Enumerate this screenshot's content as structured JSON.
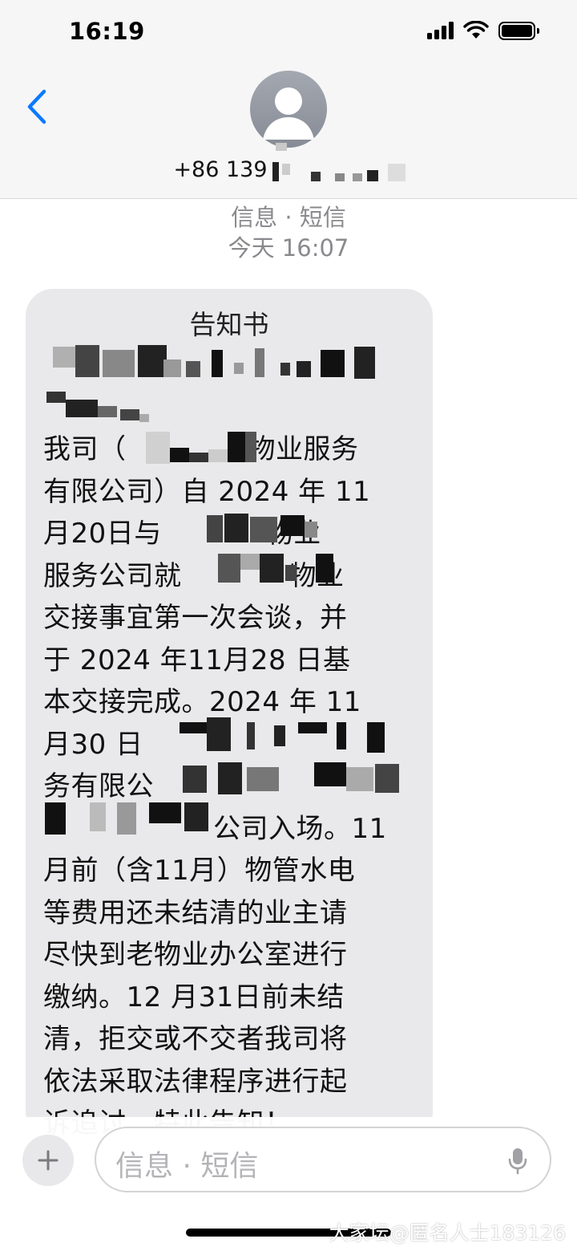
{
  "status_bar": {
    "time": "16:19"
  },
  "contact": {
    "number_prefix": "+86 139"
  },
  "meta": {
    "channel": "信息 · 短信",
    "timestamp": "今天 16:07"
  },
  "message": {
    "title": "告知书",
    "lines": [
      "我司（",
      "物业服务",
      "有限公司）自 2024 年 11",
      "月20日与",
      "物业",
      "服务公司就",
      "物业",
      "交接事宜第一次会谈，并",
      "于 2024 年11月28 日基",
      "本交接完成。2024 年 11",
      "月30 日",
      "务有限公",
      "公司入场。11",
      "月前（含11月）物管水电",
      "等费用还未结清的业主请",
      "尽快到老物业办公室进行",
      "缴纳。12 月31日前未结",
      "清，拒交或不交者我司将",
      "依法采取法律程序进行起",
      "诉追讨，特此告知！"
    ]
  },
  "composer": {
    "placeholder": "信息 · 短信"
  },
  "watermark": "大家坛@匿名人士183126",
  "icons": {
    "back": "chevron-left-icon",
    "avatar": "person-icon",
    "plus": "plus-icon",
    "mic": "microphone-icon",
    "signal": "cellular-signal-icon",
    "wifi": "wifi-icon",
    "battery": "battery-icon"
  },
  "colors": {
    "accent": "#0a7aff",
    "bubble": "#e9e9eb",
    "meta_text": "#8a8a8e"
  }
}
